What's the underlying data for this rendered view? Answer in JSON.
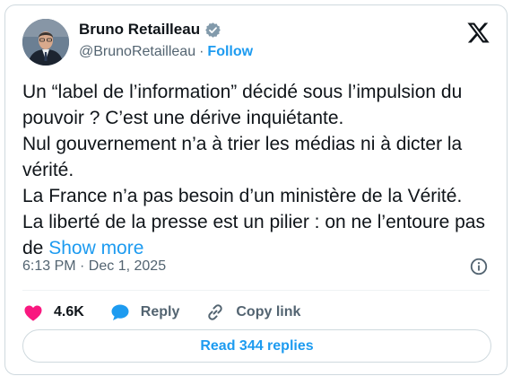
{
  "author": {
    "name": "Bruno Retailleau",
    "handle": "@BrunoRetailleau",
    "verified": true,
    "follow_label": "Follow",
    "separator": "·"
  },
  "platform_logo": "x-logo-icon",
  "tweet": {
    "text": "Un “label de l’information” décidé sous l’impulsion du pouvoir ? C’est une dérive inquiétante.\nNul gouvernement n’a à trier les médias ni à dicter la vérité.\nLa France n’a pas besoin d’un ministère de la Vérité.\nLa liberté de la presse est un pilier : on ne l’entoure pas de ",
    "show_more_label": "Show more",
    "timestamp": "6:13 PM · Dec 1, 2025"
  },
  "actions": {
    "like_count": "4.6K",
    "reply_label": "Reply",
    "copy_link_label": "Copy link"
  },
  "replies_button_label": "Read 344 replies",
  "colors": {
    "accent": "#1d9bf0",
    "like": "#f91880",
    "text": "#0f1419",
    "muted": "#536471",
    "border": "#cfd9de",
    "verified_badge": "#829aab"
  }
}
